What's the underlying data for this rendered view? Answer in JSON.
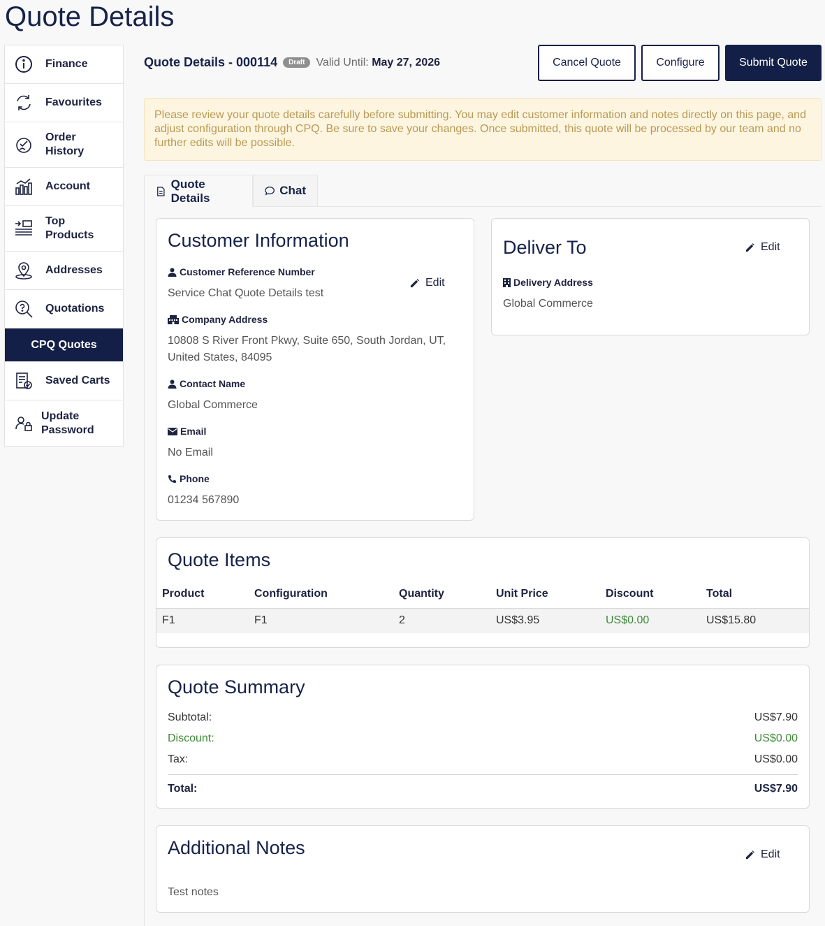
{
  "page": {
    "title": "Quote Details"
  },
  "sidebar": {
    "items": [
      {
        "label": "Finance",
        "icon": "info-icon"
      },
      {
        "label": "Favourites",
        "icon": "refresh-icon"
      },
      {
        "label": "Order History",
        "icon": "order-history-icon"
      },
      {
        "label": "Account",
        "icon": "chart-icon"
      },
      {
        "label": "Top Products",
        "icon": "list-icon"
      },
      {
        "label": "Addresses",
        "icon": "map-pin-icon"
      },
      {
        "label": "Quotations",
        "icon": "search-question-icon"
      },
      {
        "label": "CPQ Quotes",
        "icon": ""
      },
      {
        "label": "Saved Carts",
        "icon": "checklist-icon"
      },
      {
        "label": "Update Password",
        "icon": "user-lock-icon"
      }
    ]
  },
  "quote": {
    "title": "Quote Details - 000114",
    "status": "Draft",
    "valid_label": "Valid Until:",
    "valid_date": "May 27, 2026"
  },
  "actions": {
    "cancel": "Cancel Quote",
    "configure": "Configure",
    "submit": "Submit Quote"
  },
  "alert": "Please review your quote details carefully before submitting. You may edit customer information and notes directly on this page, and adjust configuration through CPQ. Be sure to save your changes. Once submitted, this quote will be processed by our team and no further edits will be possible.",
  "tabs": [
    {
      "label": "Quote Details"
    },
    {
      "label": "Chat"
    }
  ],
  "customer": {
    "title": "Customer Information",
    "edit": "Edit",
    "ref_label": "Customer Reference Number",
    "ref_value": "Service Chat Quote Details test",
    "address_label": "Company Address",
    "address_line1": "10808 S River Front Pkwy, Suite 650, South Jordan, UT,",
    "address_line2": "United States, 84095",
    "contact_label": "Contact Name",
    "contact_value": "Global Commerce",
    "email_label": "Email",
    "email_value": "No Email",
    "phone_label": "Phone",
    "phone_value": "01234 567890"
  },
  "deliver": {
    "title": "Deliver To",
    "edit": "Edit",
    "address_label": "Delivery Address",
    "address_value": "Global Commerce"
  },
  "items": {
    "title": "Quote Items",
    "headers": [
      "Product",
      "Configuration",
      "Quantity",
      "Unit Price",
      "Discount",
      "Total"
    ],
    "rows": [
      {
        "product": "F1",
        "configuration": "F1",
        "quantity": "2",
        "unit_price": "US$3.95",
        "discount": "US$0.00",
        "total": "US$15.80"
      }
    ]
  },
  "summary": {
    "title": "Quote Summary",
    "subtotal_label": "Subtotal:",
    "subtotal": "US$7.90",
    "discount_label": "Discount:",
    "discount": "US$0.00",
    "tax_label": "Tax:",
    "tax": "US$0.00",
    "total_label": "Total:",
    "total": "US$7.90"
  },
  "notes": {
    "title": "Additional Notes",
    "edit": "Edit",
    "text": "Test notes"
  },
  "colors": {
    "navy": "#131f46",
    "discount_green": "#3f8a3a",
    "alert_bg": "#fdf5e0",
    "alert_text": "#b89a55"
  }
}
